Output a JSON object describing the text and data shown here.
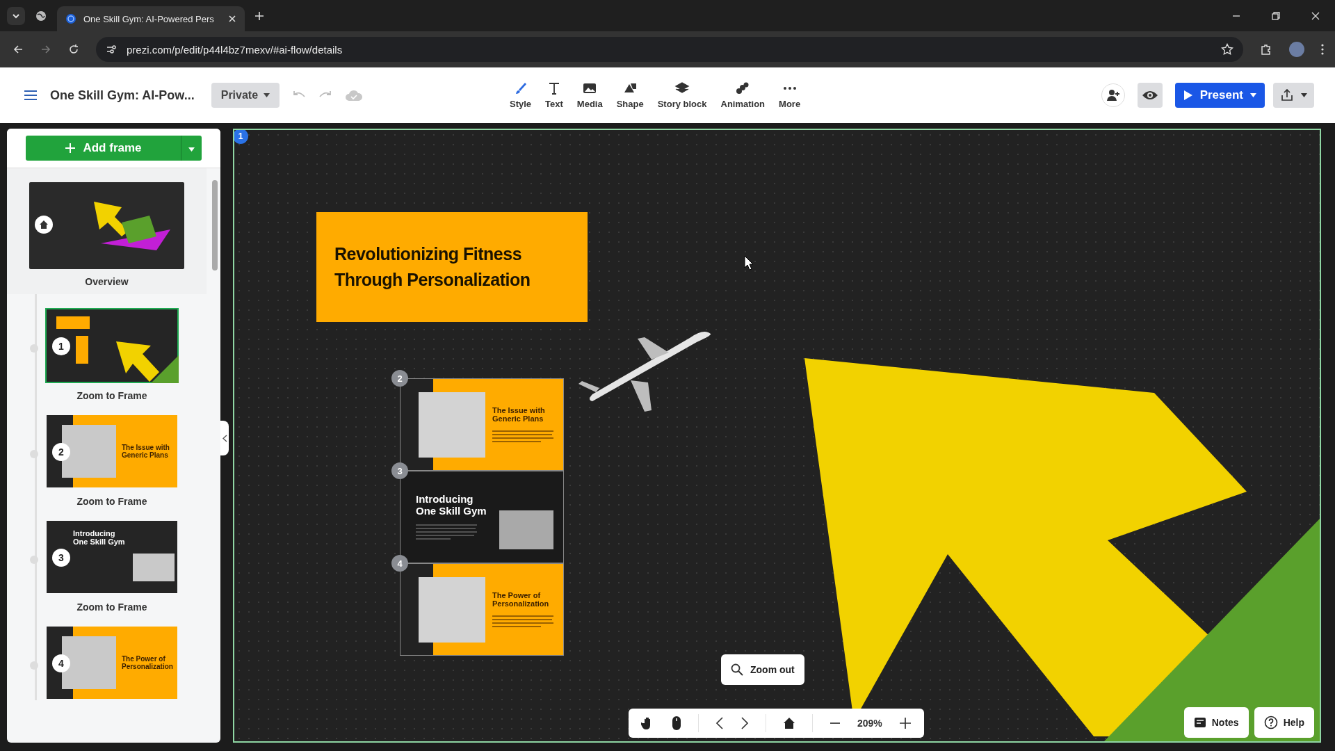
{
  "browser": {
    "tab_title": "One Skill Gym: AI-Powered Pers",
    "url": "prezi.com/p/edit/p44l4bz7mexv/#ai-flow/details"
  },
  "toolbar": {
    "title": "One Skill Gym: AI-Pow...",
    "privacy": "Private",
    "tools": [
      {
        "kind": "style",
        "label": "Style"
      },
      {
        "kind": "text",
        "label": "Text"
      },
      {
        "kind": "media",
        "label": "Media"
      },
      {
        "kind": "shape",
        "label": "Shape"
      },
      {
        "kind": "story",
        "label": "Story block"
      },
      {
        "kind": "animation",
        "label": "Animation"
      },
      {
        "kind": "more",
        "label": "More"
      }
    ],
    "present": "Present"
  },
  "sidebar": {
    "add_frame": "Add frame",
    "overview": "Overview",
    "frames": [
      {
        "number": "1",
        "label": "Zoom to Frame",
        "selected": true,
        "kind": "arrow"
      },
      {
        "number": "2",
        "label": "Zoom to Frame",
        "selected": false,
        "kind": "orange",
        "title": "The Issue with Generic Plans"
      },
      {
        "number": "3",
        "label": "Zoom to Frame",
        "selected": false,
        "kind": "dark",
        "title": "Introducing One Skill Gym"
      },
      {
        "number": "4",
        "selected": false,
        "kind": "orange",
        "title": "The Power of Personalization"
      }
    ]
  },
  "canvas": {
    "frame_number": "1",
    "headline": "Revolutionizing Fitness Through Personalization",
    "cards": [
      {
        "number": "2",
        "kind": "orange",
        "title": "The Issue with Generic Plans"
      },
      {
        "number": "3",
        "kind": "dark",
        "title": "Introducing One Skill Gym"
      },
      {
        "number": "4",
        "kind": "orange",
        "title": "The Power of Personalization"
      }
    ],
    "zoom_out": "Zoom out"
  },
  "bottom_bar": {
    "zoom": "209%",
    "notes": "Notes",
    "help": "Help"
  }
}
